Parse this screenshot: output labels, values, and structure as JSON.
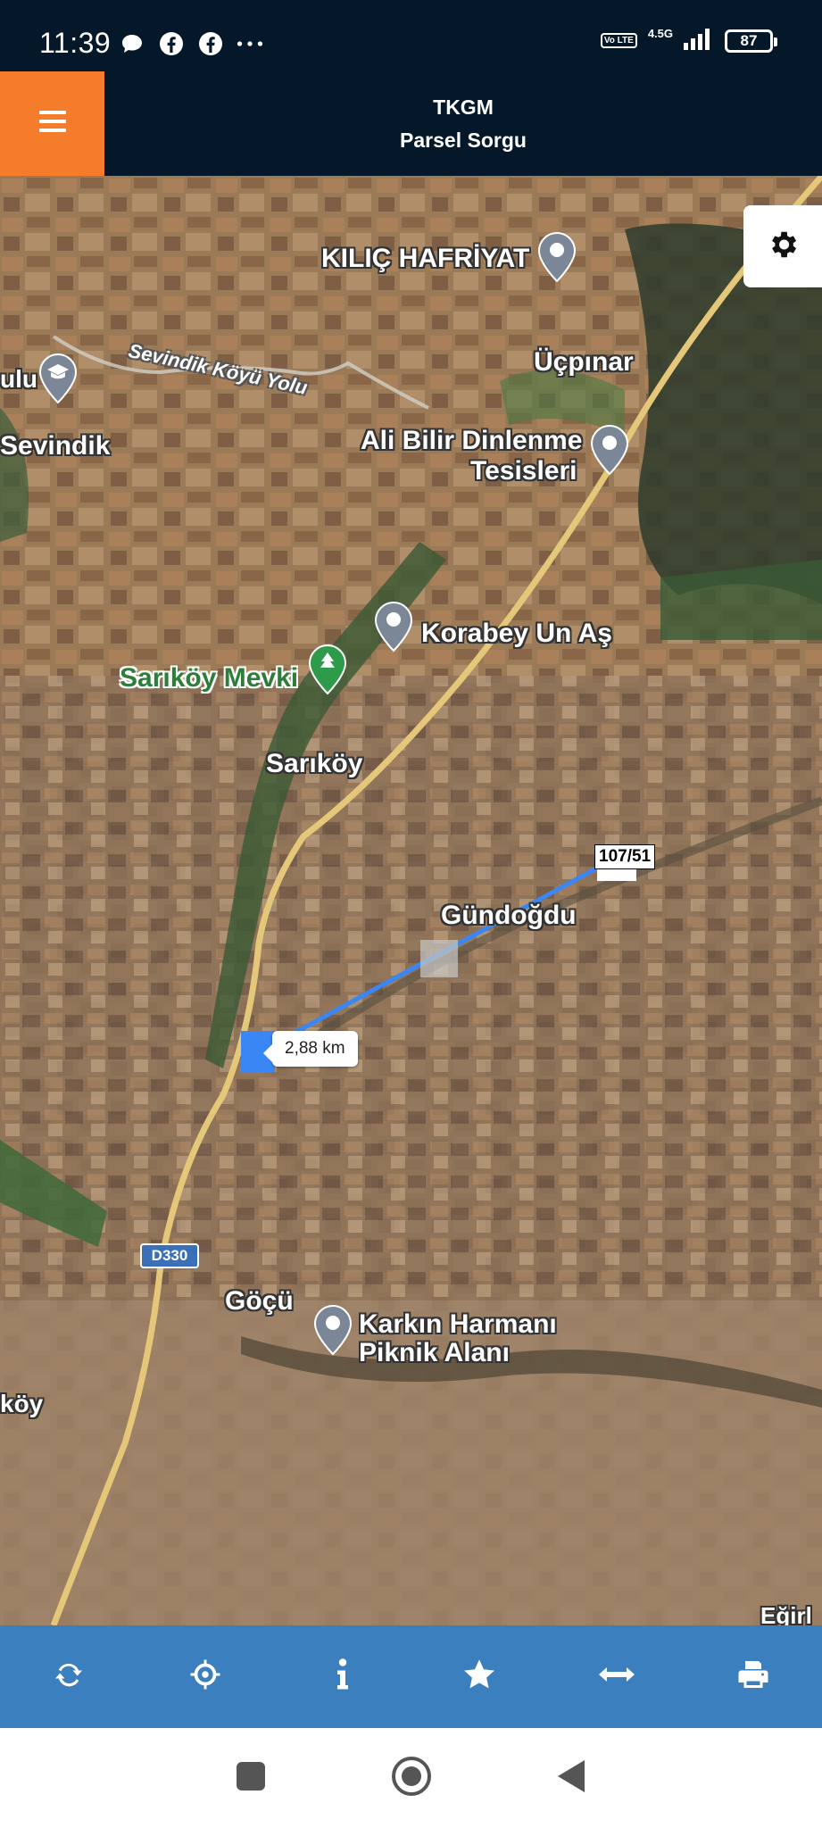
{
  "status_bar": {
    "time": "11:39",
    "left_icons": [
      "chat-icon",
      "facebook-icon",
      "facebook-icon",
      "more-dots-icon"
    ],
    "volte": "Vo LTE",
    "network": "4.5G",
    "battery": "87"
  },
  "header": {
    "title": "TKGM",
    "subtitle": "Parsel Sorgu",
    "menu_icon": "hamburger-icon",
    "accent_color": "#f57c2b",
    "bg_color": "#04182a"
  },
  "map": {
    "labels": {
      "kilic": "KILIÇ HAFRİYAT",
      "ucpinar": "Üçpınar",
      "ali_bilir_1": "Ali Bilir Dinlenme",
      "ali_bilir_2": "Tesisleri",
      "korabey": "Korabey Un Aş",
      "sarikoy_mevki": "Sarıköy Mevki",
      "sarikoy": "Sarıköy",
      "gundogdu": "Gündoğdu",
      "gocu": "Göçü",
      "karkin_1": "Karkın Harmanı",
      "karkin_2": "Piknik Alanı",
      "sevindik": "Sevindik",
      "ulu": "ulu",
      "koy": "köy",
      "egirl": "Eğirl",
      "road": "Sevindik Köyü Yolu",
      "d330": "D330"
    },
    "parcel_label": "107/51",
    "distance": "2,88 km",
    "settings_icon": "gear-icon"
  },
  "toolbar": {
    "color": "#3b7fbf",
    "buttons": [
      "refresh-icon",
      "crosshair-icon",
      "info-icon",
      "star-icon",
      "measure-icon",
      "print-icon"
    ]
  },
  "navbar": {
    "buttons": [
      "recent-apps-icon",
      "home-icon",
      "back-icon"
    ]
  }
}
